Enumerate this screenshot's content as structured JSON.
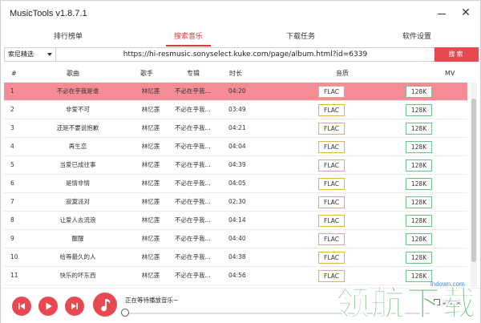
{
  "window": {
    "title": "MusicTools v1.8.7.1",
    "close_glyph": "✕"
  },
  "tabs": [
    {
      "label": "排行榜单",
      "active": false
    },
    {
      "label": "搜索音乐",
      "active": true
    },
    {
      "label": "下载任务",
      "active": false
    },
    {
      "label": "软件设置",
      "active": false
    }
  ],
  "search": {
    "source": "索尼精选",
    "url": "https://hi-resmusic.sonyselect.kuke.com/page/album.html?id=6339",
    "button_label": "搜索"
  },
  "table": {
    "headers": [
      "#",
      "歌曲",
      "歌手",
      "专辑",
      "时长",
      "音质",
      "MV"
    ],
    "rows": [
      {
        "num": "1",
        "title": "不必在乎我是谁",
        "artist": "林忆莲",
        "album": "不必在乎我...",
        "duration": "04:20",
        "quality": "FLAC",
        "mv": "128K",
        "selected": true
      },
      {
        "num": "2",
        "title": "非爱不可",
        "artist": "林忆莲",
        "album": "不必在乎我...",
        "duration": "03:49",
        "quality": "FLAC",
        "mv": "128K"
      },
      {
        "num": "3",
        "title": "还是不要说抱歉",
        "artist": "林忆莲",
        "album": "不必在乎我...",
        "duration": "04:21",
        "quality": "FLAC",
        "mv": "128K"
      },
      {
        "num": "4",
        "title": "再生恋",
        "artist": "林忆莲",
        "album": "不必在乎我...",
        "duration": "04:04",
        "quality": "FLAC",
        "mv": "128K"
      },
      {
        "num": "5",
        "title": "当爱已成往事",
        "artist": "林忆莲",
        "album": "不必在乎我...",
        "duration": "04:39",
        "quality": "FLAC",
        "mv": "128K"
      },
      {
        "num": "6",
        "title": "是情非情",
        "artist": "林忆莲",
        "album": "不必在乎我...",
        "duration": "04:05",
        "quality": "FLAC",
        "mv": "128K"
      },
      {
        "num": "7",
        "title": "寂寞派对",
        "artist": "林忆莲",
        "album": "不必在乎我...",
        "duration": "02:30",
        "quality": "FLAC",
        "mv": "128K"
      },
      {
        "num": "8",
        "title": "让爱人去流浪",
        "artist": "林忆莲",
        "album": "不必在乎我...",
        "duration": "04:14",
        "quality": "FLAC",
        "mv": "128K"
      },
      {
        "num": "9",
        "title": "醒醒",
        "artist": "林忆莲",
        "album": "不必在乎我...",
        "duration": "04:40",
        "quality": "FLAC",
        "mv": "128K"
      },
      {
        "num": "10",
        "title": "给等最久的人",
        "artist": "林忆莲",
        "album": "不必在乎我...",
        "duration": "04:38",
        "quality": "FLAC",
        "mv": "128K"
      },
      {
        "num": "11",
        "title": "快乐的坏东西",
        "artist": "林忆莲",
        "album": "不必在乎我...",
        "duration": "04:56",
        "quality": "FLAC",
        "mv": "128K"
      }
    ]
  },
  "player": {
    "status": "正在等待播放音乐~",
    "mute_label": "静音模",
    "progress": 0.0
  },
  "watermark": {
    "brand": "领航下载",
    "site": "lhdown.com"
  },
  "colors": {
    "accent": "#e8484f",
    "selected_row": "#f48c96",
    "flac_border": "#e5b24a",
    "mv_border": "#6dc487"
  },
  "icons": {
    "prev": "skip-previous-icon",
    "play": "play-icon",
    "next": "skip-next-icon",
    "note": "music-note-icon",
    "close": "close-icon",
    "minimize": "minimize-icon",
    "dropdown": "chevron-down-icon"
  }
}
